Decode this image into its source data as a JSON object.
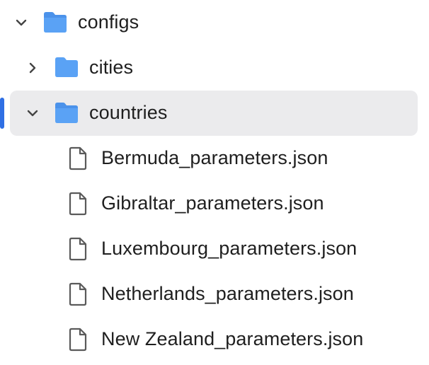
{
  "tree": {
    "root": {
      "label": "configs",
      "expanded": true,
      "icon": "folder-open-icon",
      "children": [
        {
          "label": "cities",
          "expanded": false,
          "icon": "folder-icon"
        },
        {
          "label": "countries",
          "expanded": true,
          "selected": true,
          "icon": "folder-open-icon",
          "children": [
            {
              "label": "Bermuda_parameters.json",
              "icon": "file-icon"
            },
            {
              "label": "Gibraltar_parameters.json",
              "icon": "file-icon"
            },
            {
              "label": "Luxembourg_parameters.json",
              "icon": "file-icon"
            },
            {
              "label": "Netherlands_parameters.json",
              "icon": "file-icon"
            },
            {
              "label": "New Zealand_parameters.json",
              "icon": "file-icon"
            }
          ]
        }
      ]
    }
  },
  "colors": {
    "folder": "#5aa2f5",
    "folder_dark": "#4b92ea",
    "selection_bg": "#ebebed",
    "active_indicator": "#2f6fe4",
    "text": "#1f1f1f",
    "chevron": "#444444",
    "file_outline": "#5a5a5a"
  }
}
